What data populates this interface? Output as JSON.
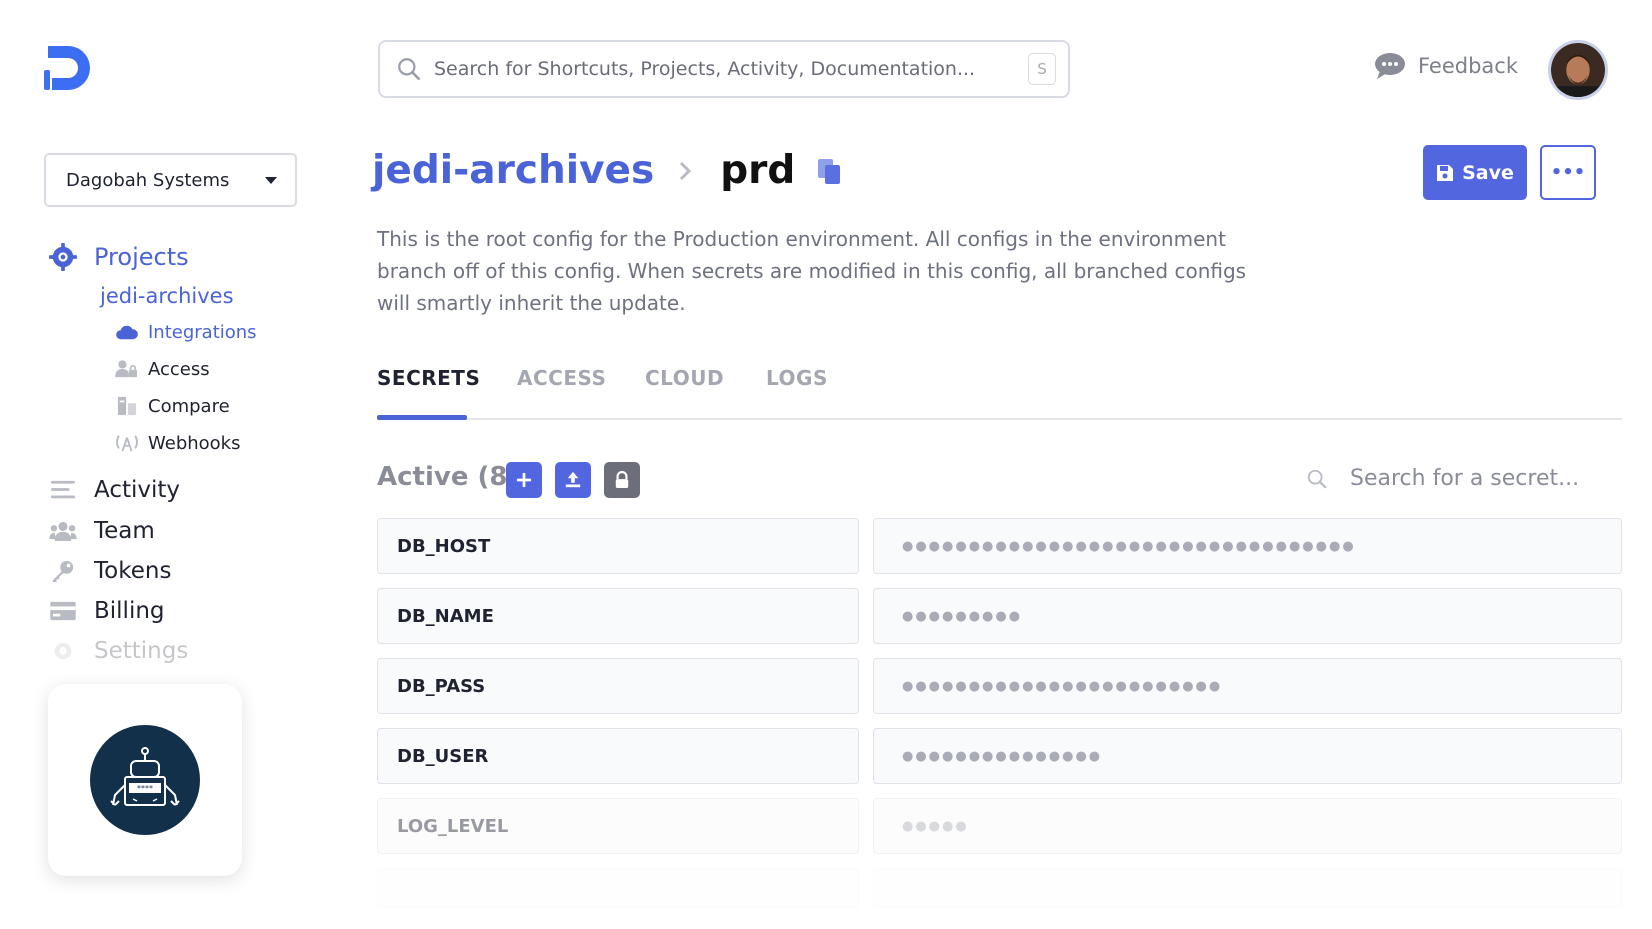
{
  "app": {
    "logo_name": "doppler-logo"
  },
  "search": {
    "placeholder": "Search for Shortcuts, Projects, Activity, Documentation...",
    "shortcut_key": "S"
  },
  "header": {
    "feedback_label": "Feedback"
  },
  "workspace": {
    "name": "Dagobah Systems"
  },
  "sidebar": {
    "projects_label": "Projects",
    "project_name": "jedi-archives",
    "project_items": [
      {
        "label": "Integrations",
        "icon": "cloud-icon",
        "active": true
      },
      {
        "label": "Access",
        "icon": "users-lock-icon"
      },
      {
        "label": "Compare",
        "icon": "compare-icon"
      },
      {
        "label": "Webhooks",
        "icon": "broadcast-icon"
      }
    ],
    "main_items": [
      {
        "label": "Activity",
        "icon": "list-icon"
      },
      {
        "label": "Team",
        "icon": "team-icon"
      },
      {
        "label": "Tokens",
        "icon": "key-icon"
      },
      {
        "label": "Billing",
        "icon": "credit-card-icon"
      },
      {
        "label": "Settings",
        "icon": "gear-icon"
      }
    ]
  },
  "page": {
    "project": "jedi-archives",
    "environment": "prd",
    "save_label": "Save",
    "more_label": "•••",
    "description": "This is the root config for the Production environment. All configs in the environment branch off of this config. When secrets are modified in this config, all branched configs will smartly inherit the update."
  },
  "tabs": [
    "SECRETS",
    "ACCESS",
    "CLOUD",
    "LOGS"
  ],
  "secrets": {
    "active_label": "Active (8)",
    "search_placeholder": "Search for a secret...",
    "rows": [
      {
        "key": "DB_HOST",
        "masked": "●●●●●●●●●●●●●●●●●●●●●●●●●●●●●●●●●●"
      },
      {
        "key": "DB_NAME",
        "masked": "●●●●●●●●●"
      },
      {
        "key": "DB_PASS",
        "masked": "●●●●●●●●●●●●●●●●●●●●●●●●"
      },
      {
        "key": "DB_USER",
        "masked": "●●●●●●●●●●●●●●●"
      },
      {
        "key": "LOG_LEVEL",
        "masked": "●●●●●"
      }
    ]
  },
  "colors": {
    "accent": "#4a63d6",
    "button": "#5266e0",
    "lock_button": "#6c6f7a"
  }
}
